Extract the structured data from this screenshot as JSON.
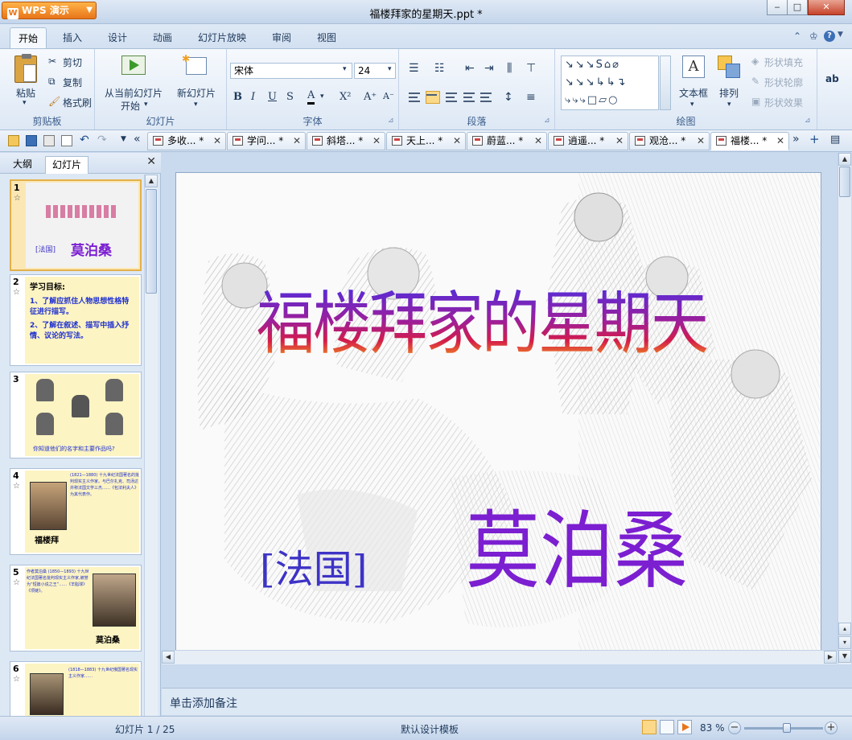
{
  "app": {
    "logo": "WPS 演示",
    "title": "福楼拜家的星期天.ppt *"
  },
  "window_controls": {
    "minimize": "‒",
    "restore": "□",
    "close": "✕"
  },
  "ribbon_tabs": [
    "开始",
    "插入",
    "设计",
    "动画",
    "幻灯片放映",
    "审阅",
    "视图"
  ],
  "ribbon": {
    "clipboard": {
      "paste": "粘贴",
      "cut": "剪切",
      "copy": "复制",
      "format_painter": "格式刷",
      "label": "剪贴板"
    },
    "slides": {
      "from_current_line1": "从当前幻灯片",
      "from_current_line2": "开始",
      "new_slide": "新幻灯片",
      "label": "幻灯片"
    },
    "font": {
      "name": "宋体",
      "size": "24",
      "bold": "B",
      "italic": "I",
      "underline": "U",
      "shadow": "S",
      "color": "A",
      "superscript": "X²",
      "grow": "A⁺",
      "shrink": "A⁻",
      "label": "字体"
    },
    "paragraph": {
      "label": "段落"
    },
    "drawing": {
      "shapes_row1": "↘↘↘S⌂⌀",
      "shapes_row2": "↘↘↘↳↳↴",
      "shapes_row3": "⤷⤷⤷□▱○",
      "textbox": "文本框",
      "arrange": "排列",
      "fill": "形状填充",
      "outline": "形状轮廓",
      "effects": "形状效果",
      "label": "绘图"
    },
    "extra": {
      "truncated": "ab"
    }
  },
  "doc_tabs": [
    {
      "label": "多收... *",
      "close": "✕"
    },
    {
      "label": "学问... *",
      "close": "✕"
    },
    {
      "label": "斜塔... *",
      "close": "✕"
    },
    {
      "label": "天上... *",
      "close": "✕"
    },
    {
      "label": "蔚蓝... *",
      "close": "✕"
    },
    {
      "label": "逍遥... *",
      "close": "✕"
    },
    {
      "label": "观沧... *",
      "close": "✕"
    },
    {
      "label": "福楼... *",
      "close": "✕"
    }
  ],
  "left_pane": {
    "tabs": [
      "大纲",
      "幻灯片"
    ],
    "close": "✕",
    "thumbnails": [
      {
        "num": "1",
        "caption1": "[法国]",
        "caption2": "莫泊桑"
      },
      {
        "num": "2",
        "heading": "学习目标:",
        "line1": "1、了解应抓住人物思想性格特征进行描写。",
        "line2": "2、了解在叙述、描写中插入抒情、议论的写法。"
      },
      {
        "num": "3",
        "caption": "你知道他们的名字和主要作品吗?"
      },
      {
        "num": "4",
        "caption": "福楼拜",
        "text": "(1821—1880) 十九世纪法国著名的批判现实主义作家。与巴尔扎克、司汤达并称法国文学三杰……《包法利夫人》为其代表作。"
      },
      {
        "num": "5",
        "caption": "莫泊桑",
        "text": "作者莫泊桑 (1850—1893) 十九世纪法国著名批判现实主义作家,被誉为“短篇小说之王”……《羊脂球》《项链》。"
      },
      {
        "num": "6",
        "text": "(1818—1883) 十九世纪俄国著名现实主义作家……"
      }
    ]
  },
  "slide": {
    "title": "福楼拜家的星期天",
    "country": "[法国]",
    "author": "莫泊桑"
  },
  "notes_placeholder": "单击添加备注",
  "status": {
    "slide_counter": "幻灯片 1 / 25",
    "template": "默认设计模板",
    "zoom": "83 %",
    "zoom_level": 0.55
  },
  "colors": {
    "accent": "#e8751a",
    "title_top": "#5a2bd6",
    "title_bottom": "#f28b1e",
    "author": "#7b1fd1",
    "country": "#3d33c6"
  }
}
